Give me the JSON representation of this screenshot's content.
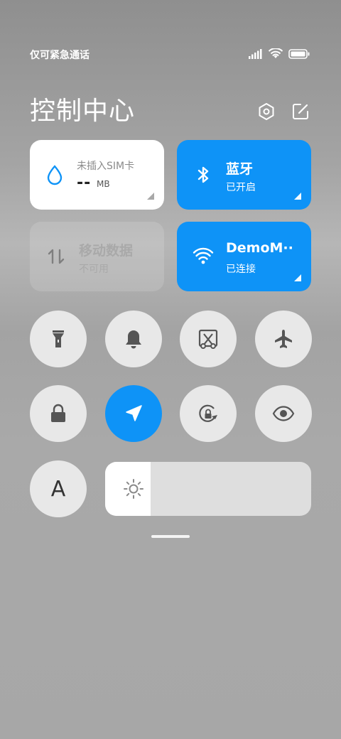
{
  "status_bar": {
    "carrier": "仅可紧急通话",
    "icons": [
      "signal-icon",
      "wifi-icon",
      "battery-icon"
    ],
    "battery_level_pct": 100
  },
  "header": {
    "title": "控制中心",
    "icons": [
      "settings-icon",
      "edit-icon"
    ]
  },
  "tiles": {
    "data_usage": {
      "label": "未插入SIM卡",
      "value": "--",
      "unit": "MB",
      "icon": "water-drop-icon"
    },
    "bluetooth": {
      "title": "蓝牙",
      "status": "已开启",
      "icon": "bluetooth-icon"
    },
    "mobile_data": {
      "title": "移动数据",
      "status": "不可用",
      "icon": "data-arrows-icon"
    },
    "wifi": {
      "title": "DemoM··",
      "status": "已连接",
      "icon": "wifi-icon"
    }
  },
  "toggles_row1": [
    "flashlight-icon",
    "bell-icon",
    "screenshot-icon",
    "airplane-icon"
  ],
  "toggles_row2": [
    "lock-icon",
    "location-icon",
    "rotation-lock-icon",
    "eye-icon"
  ],
  "font_toggle": {
    "label": "A"
  },
  "brightness": {
    "level_pct": 22,
    "icon": "brightness-icon"
  },
  "colors": {
    "accent": "#0e93f7",
    "tile_white": "#ffffff",
    "circle_bg": "#e8e8e8"
  }
}
